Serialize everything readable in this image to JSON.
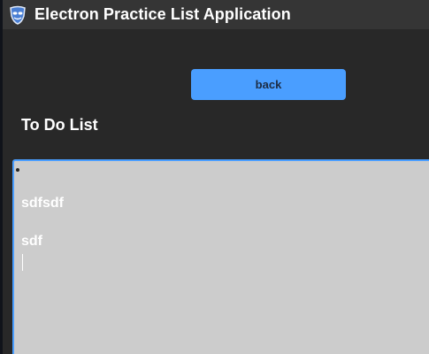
{
  "window": {
    "title": "Electron Practice List Application",
    "icon": "mask-app-icon"
  },
  "toolbar": {
    "back_label": "back"
  },
  "main": {
    "heading": "To Do List",
    "list_items": [
      "sdfsdf",
      "sdf"
    ]
  },
  "colors": {
    "accent": "#4a9eff",
    "window_bg": "#282828",
    "titlebar_bg": "#353535",
    "editor_bg": "#cccccc",
    "text": "#ffffff"
  }
}
